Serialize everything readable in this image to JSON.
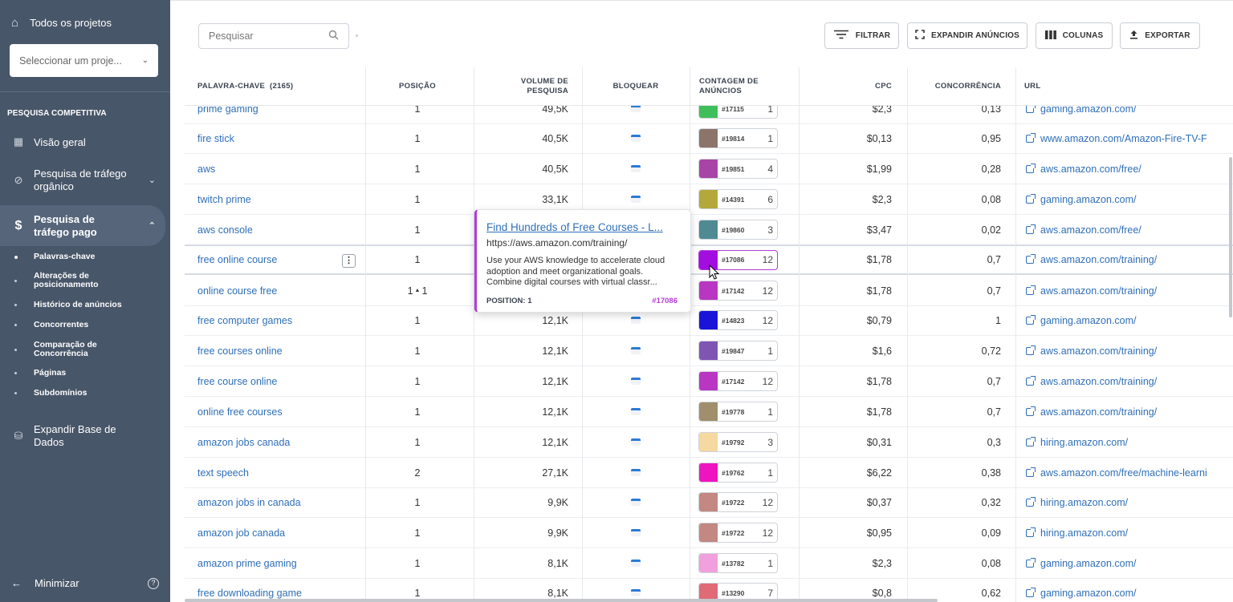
{
  "sidebar": {
    "all_projects": "Todos os projetos",
    "project_select_placeholder": "Seleccionar um proje...",
    "section_title": "PESQUISA COMPETITIVA",
    "items": [
      {
        "label": "Visão geral",
        "icon": "grid-icon"
      },
      {
        "label": "Pesquisa de tráfego orgânico",
        "icon": "leaf-icon"
      },
      {
        "label": "Pesquisa de tráfego pago",
        "icon": "dollar-icon"
      }
    ],
    "sub_items": [
      {
        "label": "Palavras-chave",
        "active": true
      },
      {
        "label": "Alterações de posicionamento"
      },
      {
        "label": "Histórico de anúncios"
      },
      {
        "label": "Concorrentes"
      },
      {
        "label": "Comparação de Concorrência"
      },
      {
        "label": "Páginas"
      },
      {
        "label": "Subdomínios"
      }
    ],
    "expand_db": "Expandir Base de Dados",
    "minimize": "Minimizar"
  },
  "toolbar": {
    "search_placeholder": "Pesquisar",
    "filter": "FILTRAR",
    "expand_ads": "EXPANDIR ANÚNCIOS",
    "columns": "COLUNAS",
    "export": "EXPORTAR"
  },
  "table": {
    "headers": {
      "keyword": "PALAVRA-CHAVE",
      "keyword_count": "(2165)",
      "position": "POSIÇÃO",
      "volume": "VOLUME DE PESQUISA",
      "block": "BLOQUEAR",
      "ad_count": "CONTAGEM DE ANÚNCIOS",
      "cpc": "CPC",
      "competition": "CONCORRÊNCIA",
      "url": "URL"
    },
    "rows": [
      {
        "kw": "prime gaming",
        "pos": "1",
        "vol": "49,5K",
        "color": "#3fbf5a",
        "id": "#17115",
        "n": "1",
        "cpc": "$2,3",
        "conc": "0,13",
        "url": "gaming.amazon.com/"
      },
      {
        "kw": "fire stick",
        "pos": "1",
        "vol": "40,5K",
        "color": "#8c746b",
        "id": "#19814",
        "n": "1",
        "cpc": "$0,13",
        "conc": "0,95",
        "url": "www.amazon.com/Amazon-Fire-TV-F"
      },
      {
        "kw": "aws",
        "pos": "1",
        "vol": "40,5K",
        "color": "#a844a6",
        "id": "#19851",
        "n": "4",
        "cpc": "$1,99",
        "conc": "0,28",
        "url": "aws.amazon.com/free/"
      },
      {
        "kw": "twitch prime",
        "pos": "1",
        "vol": "33,1K",
        "color": "#b5a83a",
        "id": "#14391",
        "n": "6",
        "cpc": "$2,3",
        "conc": "0,08",
        "url": "gaming.amazon.com/"
      },
      {
        "kw": "aws console",
        "pos": "1",
        "vol": "",
        "color": "#4f8a93",
        "id": "#19860",
        "n": "3",
        "cpc": "$3,47",
        "conc": "0,02",
        "url": "aws.amazon.com/free/"
      },
      {
        "kw": "free online course",
        "pos": "1",
        "vol": "",
        "color": "#a20ee0",
        "id": "#17086",
        "n": "12",
        "cpc": "$1,78",
        "conc": "0,7",
        "url": "aws.amazon.com/training/"
      },
      {
        "kw": "online course free",
        "pos": "1",
        "pos_change": "1",
        "vol": "",
        "color": "#b936c2",
        "id": "#17142",
        "n": "12",
        "cpc": "$1,78",
        "conc": "0,7",
        "url": "aws.amazon.com/training/"
      },
      {
        "kw": "free computer games",
        "pos": "1",
        "vol": "12,1K",
        "color": "#1a14d8",
        "id": "#14823",
        "n": "12",
        "cpc": "$0,79",
        "conc": "1",
        "url": "gaming.amazon.com/"
      },
      {
        "kw": "free courses online",
        "pos": "1",
        "vol": "12,1K",
        "color": "#7f55b2",
        "id": "#19847",
        "n": "1",
        "cpc": "$1,6",
        "conc": "0,72",
        "url": "aws.amazon.com/training/"
      },
      {
        "kw": "free course online",
        "pos": "1",
        "vol": "12,1K",
        "color": "#b936c2",
        "id": "#17142",
        "n": "12",
        "cpc": "$1,78",
        "conc": "0,7",
        "url": "aws.amazon.com/training/"
      },
      {
        "kw": "online free courses",
        "pos": "1",
        "vol": "12,1K",
        "color": "#a08e6c",
        "id": "#19778",
        "n": "1",
        "cpc": "$1,78",
        "conc": "0,7",
        "url": "aws.amazon.com/training/"
      },
      {
        "kw": "amazon jobs canada",
        "pos": "1",
        "vol": "12,1K",
        "color": "#f5d9a0",
        "id": "#19792",
        "n": "3",
        "cpc": "$0,31",
        "conc": "0,3",
        "url": "hiring.amazon.com/"
      },
      {
        "kw": "text speech",
        "pos": "2",
        "vol": "27,1K",
        "color": "#ee15c0",
        "id": "#19762",
        "n": "1",
        "cpc": "$6,22",
        "conc": "0,38",
        "url": "aws.amazon.com/free/machine-learni"
      },
      {
        "kw": "amazon jobs in canada",
        "pos": "1",
        "vol": "9,9K",
        "color": "#c28881",
        "id": "#19722",
        "n": "12",
        "cpc": "$0,37",
        "conc": "0,32",
        "url": "hiring.amazon.com/"
      },
      {
        "kw": "amazon job canada",
        "pos": "1",
        "vol": "9,9K",
        "color": "#c28881",
        "id": "#19722",
        "n": "12",
        "cpc": "$0,95",
        "conc": "0,09",
        "url": "hiring.amazon.com/"
      },
      {
        "kw": "amazon prime gaming",
        "pos": "1",
        "vol": "8,1K",
        "color": "#f0a0dc",
        "id": "#13782",
        "n": "1",
        "cpc": "$2,3",
        "conc": "0,08",
        "url": "gaming.amazon.com/"
      },
      {
        "kw": "free downloading game",
        "pos": "1",
        "vol": "8,1K",
        "color": "#e06a75",
        "id": "#13290",
        "n": "7",
        "cpc": "$0,8",
        "conc": "0,62",
        "url": "gaming.amazon.com/"
      }
    ]
  },
  "popup": {
    "title": "Find Hundreds of Free Courses - L...",
    "url": "https://aws.amazon.com/training/",
    "description": "Use your AWS knowledge to accelerate cloud adoption and meet organizational goals. Combine digital courses with virtual classr...",
    "position": "POSITION: 1",
    "ad_id": "#17086"
  },
  "colors": {
    "sidebar": "#485669",
    "accent": "#2f6fb8",
    "highlight": "#b23cd6"
  }
}
